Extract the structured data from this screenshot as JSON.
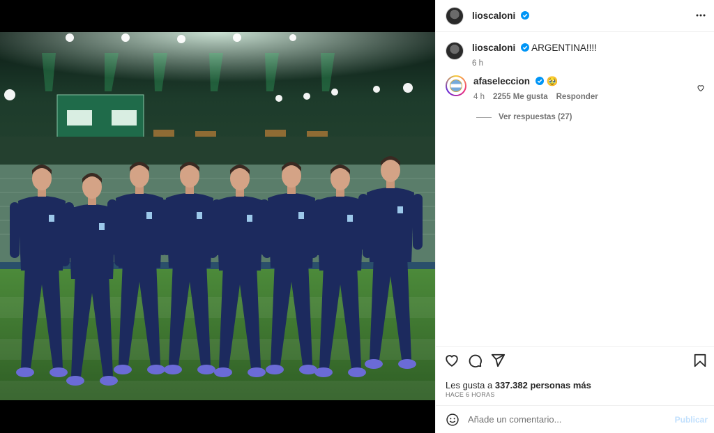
{
  "post": {
    "username": "lioscaloni",
    "verified": true
  },
  "caption": {
    "username": "lioscaloni",
    "text": "ARGENTINA!!!!",
    "time": "6 h"
  },
  "comments": [
    {
      "username": "afaseleccion",
      "text": "🥹",
      "time": "4 h",
      "likes": "2255 Me gusta",
      "reply_label": "Responder",
      "view_replies": "Ver respuestas (27)"
    }
  ],
  "likes": {
    "prefix": "Les gusta a",
    "count": "337.382 personas más"
  },
  "timestamp": "HACE 6 HORAS",
  "comment_box": {
    "placeholder": "Añade un comentario...",
    "publish_label": "Publicar"
  },
  "colors": {
    "verified_blue": "#0095f6",
    "kit_navy": "#1c2a5e",
    "grass": "#3a6b2e"
  },
  "icons": [
    "more-options-icon",
    "verified-icon",
    "heart-icon",
    "comment-icon",
    "share-icon",
    "bookmark-icon",
    "emoji-icon"
  ]
}
